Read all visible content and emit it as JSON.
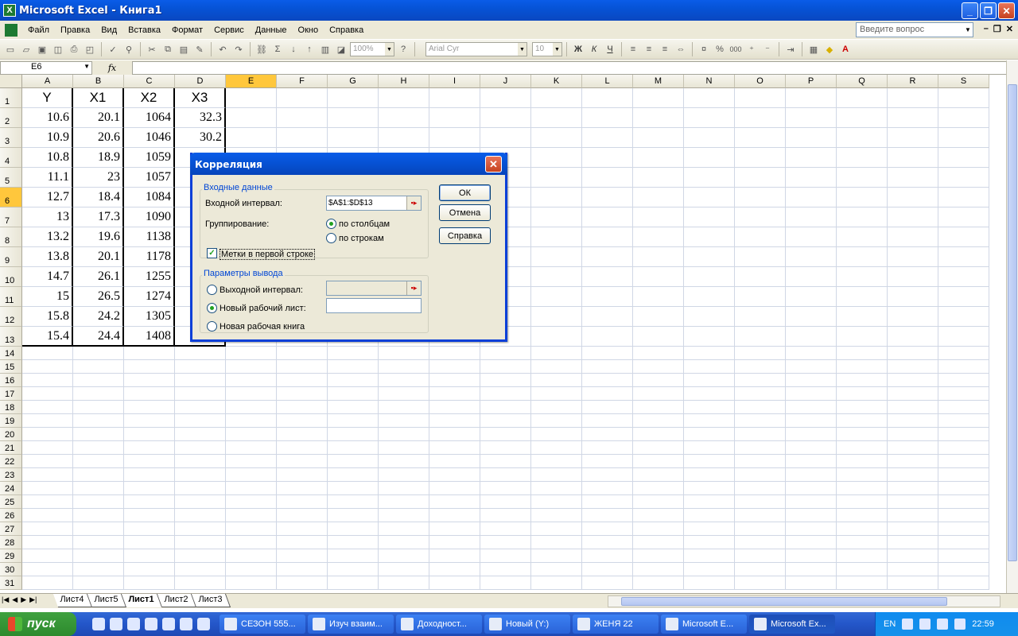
{
  "window": {
    "title": "Microsoft Excel - Книга1"
  },
  "menu": [
    "Файл",
    "Правка",
    "Вид",
    "Вставка",
    "Формат",
    "Сервис",
    "Данные",
    "Окно",
    "Справка"
  ],
  "ask_placeholder": "Введите вопрос",
  "toolbar": {
    "zoom": "100%",
    "font": "Arial Cyr",
    "size": "10",
    "bold": "Ж",
    "italic": "К",
    "underline": "Ч",
    "percent": "%",
    "thousands": "000"
  },
  "formula_bar": {
    "name_box": "E6",
    "fx": "fx",
    "content": ""
  },
  "columns": [
    "A",
    "B",
    "C",
    "D",
    "E",
    "F",
    "G",
    "H",
    "I",
    "J",
    "K",
    "L",
    "M",
    "N",
    "O",
    "P",
    "Q",
    "R",
    "S"
  ],
  "active_column": "E",
  "active_row": 6,
  "sheet": {
    "header": [
      "Y",
      "X1",
      "X2",
      "X3"
    ],
    "rows": [
      [
        "10.6",
        "20.1",
        "1064",
        "32.3"
      ],
      [
        "10.9",
        "20.6",
        "1046",
        "30.2"
      ],
      [
        "10.8",
        "18.9",
        "1059",
        ""
      ],
      [
        "11.1",
        "23",
        "1057",
        ""
      ],
      [
        "12.7",
        "18.4",
        "1084",
        ""
      ],
      [
        "13",
        "17.3",
        "1090",
        ""
      ],
      [
        "13.2",
        "19.6",
        "1138",
        ""
      ],
      [
        "13.8",
        "20.1",
        "1178",
        ""
      ],
      [
        "14.7",
        "26.1",
        "1255",
        ""
      ],
      [
        "15",
        "26.5",
        "1274",
        ""
      ],
      [
        "15.8",
        "24.2",
        "1305",
        ""
      ],
      [
        "15.4",
        "24.4",
        "1408",
        ""
      ]
    ],
    "row_count": 31
  },
  "dialog": {
    "title": "Корреляция",
    "input_group": "Входные данные",
    "input_range_label": "Входной интервал:",
    "input_range_value": "$A$1:$D$13",
    "grouping_label": "Группирование:",
    "by_columns": "по столбцам",
    "by_rows": "по строкам",
    "labels_first_row": "Метки в первой строке",
    "output_group": "Параметры вывода",
    "output_range": "Выходной интервал:",
    "new_sheet": "Новый рабочий лист:",
    "new_workbook": "Новая рабочая книга",
    "ok": "ОК",
    "cancel": "Отмена",
    "help": "Справка"
  },
  "sheet_tabs": [
    "Лист4",
    "Лист5",
    "Лист1",
    "Лист2",
    "Лист3"
  ],
  "active_tab": "Лист1",
  "taskbar": {
    "start": "пуск",
    "tasks": [
      "СЕЗОН 555...",
      "Изуч взаим...",
      "Доходност...",
      "Новый (Y:)",
      "ЖЕНЯ 22",
      "Microsoft E...",
      "Microsoft Ex..."
    ],
    "lang": "EN",
    "time": "22:59"
  }
}
